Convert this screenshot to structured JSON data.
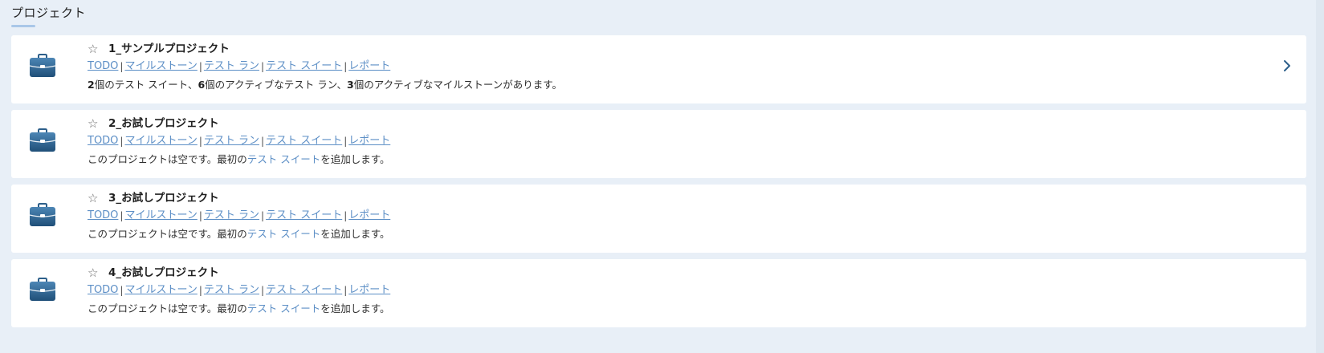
{
  "section": {
    "title": "プロジェクト"
  },
  "projects": [
    {
      "name": "1_サンプルプロジェクト",
      "links": {
        "todo": "TODO",
        "milestones": "マイルストーン",
        "test_runs": "テスト ラン",
        "test_suites": "テスト スイート",
        "reports": "レポート"
      },
      "summary": {
        "suites_count": "2",
        "part1": " 個のテスト スイート、",
        "runs_count": "6",
        "part2": " 個のアクティブなテスト ラン、",
        "milestones_count": "3",
        "part3": " 個のアクティブなマイルストーンがあります。"
      }
    },
    {
      "name": "2_お試しプロジェクト",
      "links": {
        "todo": "TODO",
        "milestones": "マイルストーン",
        "test_runs": "テスト ラン",
        "test_suites": "テスト スイート",
        "reports": "レポート"
      },
      "empty_message": {
        "before": "このプロジェクトは空です。最初の",
        "link": "テスト スイート",
        "after": "を追加します。"
      }
    },
    {
      "name": "3_お試しプロジェクト",
      "links": {
        "todo": "TODO",
        "milestones": "マイルストーン",
        "test_runs": "テスト ラン",
        "test_suites": "テスト スイート",
        "reports": "レポート"
      },
      "empty_message": {
        "before": "このプロジェクトは空です。最初の",
        "link": "テスト スイート",
        "after": "を追加します。"
      }
    },
    {
      "name": "4_お試しプロジェクト",
      "links": {
        "todo": "TODO",
        "milestones": "マイルストーン",
        "test_runs": "テスト ラン",
        "test_suites": "テスト スイート",
        "reports": "レポート"
      },
      "empty_message": {
        "before": "このプロジェクトは空です。最初の",
        "link": "テスト スイート",
        "after": "を追加します。"
      }
    }
  ],
  "separator": "|",
  "icons": {
    "project": "briefcase-icon",
    "favorite": "star-icon",
    "open": "chevron-right-icon"
  },
  "colors": {
    "link": "#5d8fc6",
    "background": "#e8eff7",
    "card": "#ffffff",
    "icon_top": "#4d86b5",
    "icon_bottom": "#1f4f78"
  }
}
